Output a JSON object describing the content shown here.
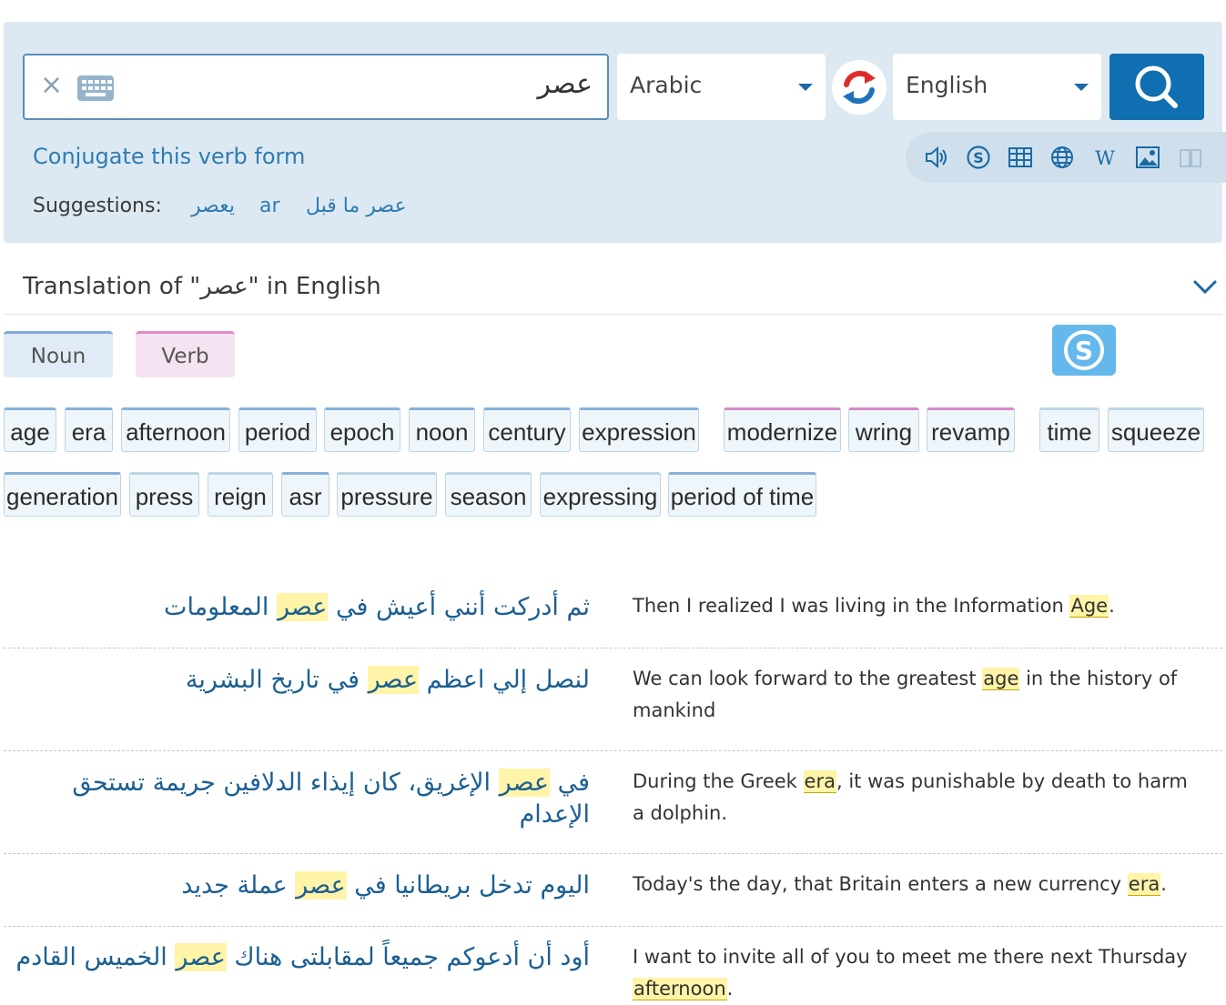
{
  "search": {
    "value": "عصر",
    "clear_label": "×"
  },
  "source_lang": "Arabic",
  "target_lang": "English",
  "conjugate_link": "Conjugate this verb form",
  "suggestions": {
    "label": "Suggestions:",
    "items": [
      "يعصر",
      "ar",
      "عصر ما قبل"
    ]
  },
  "translation_header": {
    "prefix": "Translation of \"",
    "word": "عصر",
    "suffix": "\" in English"
  },
  "pos_tabs": [
    "Noun",
    "Verb"
  ],
  "translations_noun": [
    "age",
    "era",
    "afternoon",
    "period",
    "epoch",
    "noon",
    "century",
    "expression",
    "generation",
    "press",
    "reign",
    "asr",
    "pressure",
    "season",
    "expressing",
    "period of time"
  ],
  "translations_verb": [
    "modernize",
    "wring",
    "revamp"
  ],
  "translations_other": [
    "time",
    "squeeze"
  ],
  "examples": [
    {
      "ar_before": "ثم أدركت أنني أعيش في ",
      "ar_hl": "عصر",
      "ar_after": " المعلومات",
      "en_before": "Then I realized I was living in the Information ",
      "en_hl": "Age",
      "en_after": "."
    },
    {
      "ar_before": "لنصل إلي اعظم ",
      "ar_hl": "عصر",
      "ar_after": " في تاريخ البشرية",
      "en_before": "We can look forward to the greatest ",
      "en_hl": "age",
      "en_after": " in the history of mankind"
    },
    {
      "ar_before": "في ",
      "ar_hl": "عصر",
      "ar_after": " الإغريق، كان إيذاء الدلافين جريمة تستحق الإعدام",
      "en_before": "During the Greek ",
      "en_hl": "era",
      "en_after": ", it was punishable by death to harm a dolphin."
    },
    {
      "ar_before": "اليوم تدخل بريطانيا في ",
      "ar_hl": "عصر",
      "ar_after": " عملة جديد",
      "en_before": "Today's the day, that Britain enters a new currency ",
      "en_hl": "era",
      "en_after": "."
    },
    {
      "ar_before": "أود أن أدعوكم جميعاً لمقابلتى هناك ",
      "ar_hl": "عصر",
      "ar_after": " الخميس القادم",
      "en_before": "I want to invite all of you to meet me there next Thursday ",
      "en_hl": "afternoon",
      "en_after": "."
    }
  ],
  "colors": {
    "accent": "#0f6fb0",
    "link": "#2f7cb3",
    "highlight": "#fff4a8",
    "panel": "#dde9f2"
  }
}
